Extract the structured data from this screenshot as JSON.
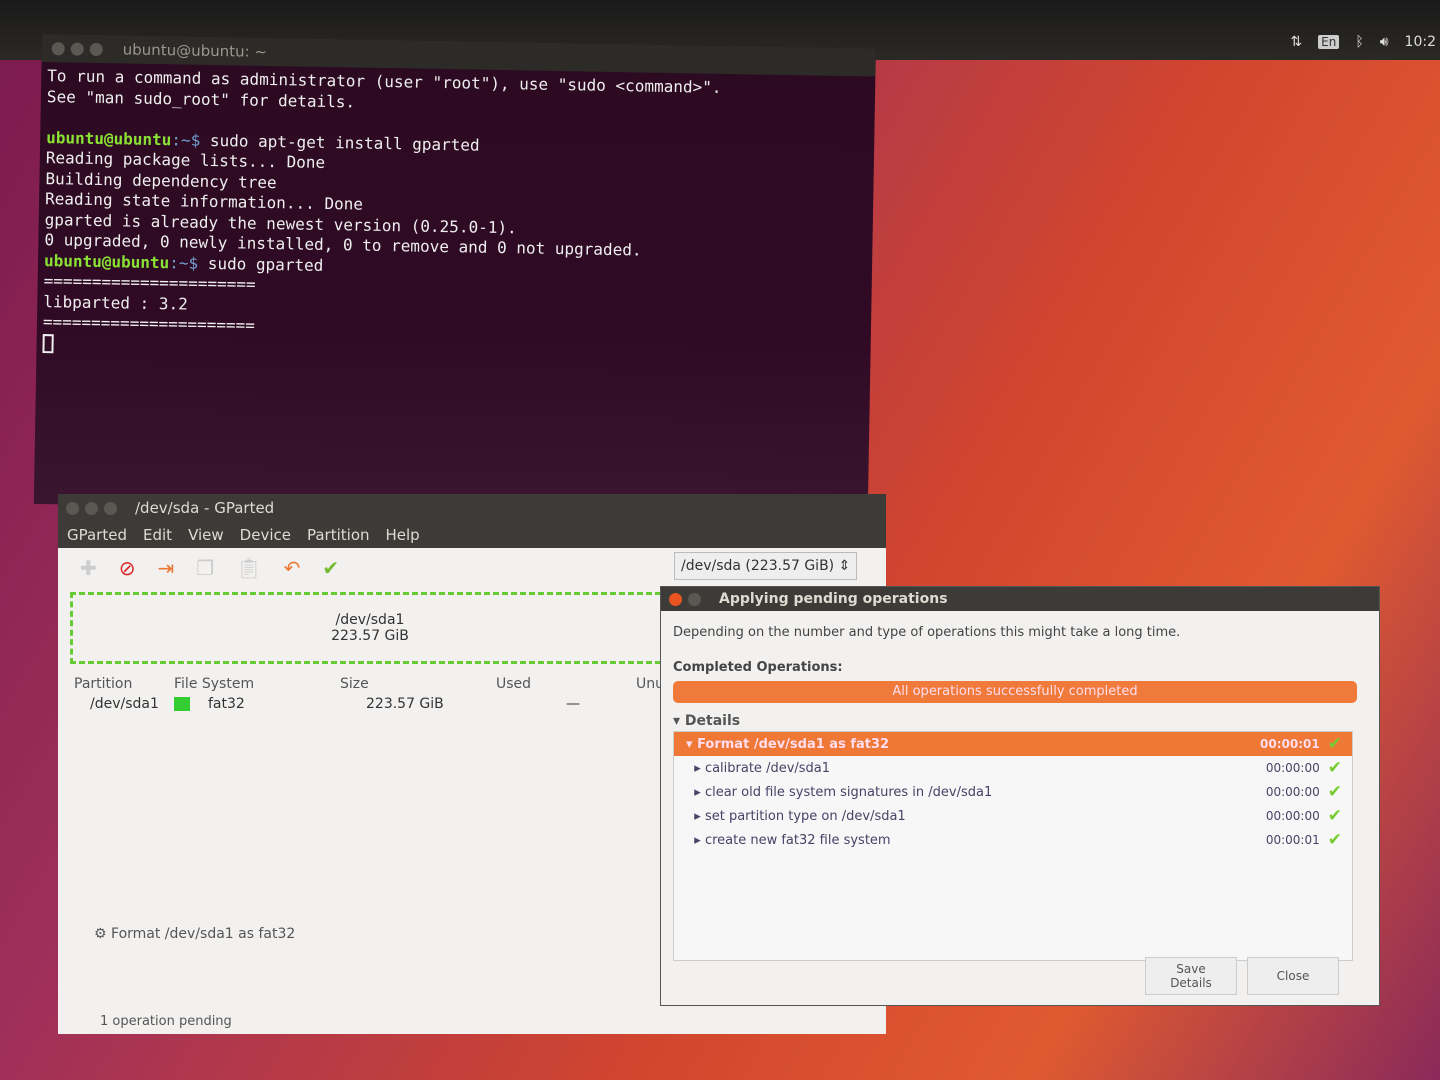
{
  "panel": {
    "keyboard": "En",
    "time": "10:2"
  },
  "terminal": {
    "title": "ubuntu@ubuntu: ~",
    "lines": [
      {
        "t": "To run a command as administrator (user \"root\"), use \"sudo <command>\"."
      },
      {
        "t": "See \"man sudo_root\" for details."
      },
      {
        "t": ""
      },
      {
        "prompt": "ubuntu@ubuntu",
        "path": ":~$",
        "t": " sudo apt-get install gparted"
      },
      {
        "t": "Reading package lists... Done"
      },
      {
        "t": "Building dependency tree"
      },
      {
        "t": "Reading state information... Done"
      },
      {
        "t": "gparted is already the newest version (0.25.0-1)."
      },
      {
        "t": "0 upgraded, 0 newly installed, 0 to remove and 0 not upgraded."
      },
      {
        "prompt": "ubuntu@ubuntu",
        "path": ":~$",
        "t": " sudo gparted"
      },
      {
        "t": "======================"
      },
      {
        "t": "libparted : 3.2"
      },
      {
        "t": "======================"
      }
    ]
  },
  "gparted": {
    "title": "/dev/sda - GParted",
    "menu": [
      "GParted",
      "Edit",
      "View",
      "Device",
      "Partition",
      "Help"
    ],
    "device": "/dev/sda  (223.57 GiB)",
    "map": {
      "name": "/dev/sda1",
      "size": "223.57 GiB"
    },
    "columns": [
      "Partition",
      "File System",
      "Size",
      "Used",
      "Unu"
    ],
    "rows": [
      {
        "partition": "/dev/sda1",
        "fs": "fat32",
        "size": "223.57 GiB",
        "used": "—"
      }
    ],
    "pending_op": "Format /dev/sda1 as fat32",
    "status": "1 operation pending"
  },
  "dialog": {
    "title": "Applying pending operations",
    "intro": "Depending on the number and type of operations this might take a long time.",
    "completed_label": "Completed Operations:",
    "progress_text": "All operations successfully completed",
    "progress": 100,
    "details_label": "Details",
    "ops": [
      {
        "label": "Format /dev/sda1 as fat32",
        "time": "00:00:01"
      },
      {
        "label": "calibrate /dev/sda1",
        "time": "00:00:00"
      },
      {
        "label": "clear old file system signatures in /dev/sda1",
        "time": "00:00:00"
      },
      {
        "label": "set partition type on /dev/sda1",
        "time": "00:00:00"
      },
      {
        "label": "create new fat32 file system",
        "time": "00:00:01"
      }
    ],
    "save_details": "Save Details",
    "close": "Close"
  }
}
